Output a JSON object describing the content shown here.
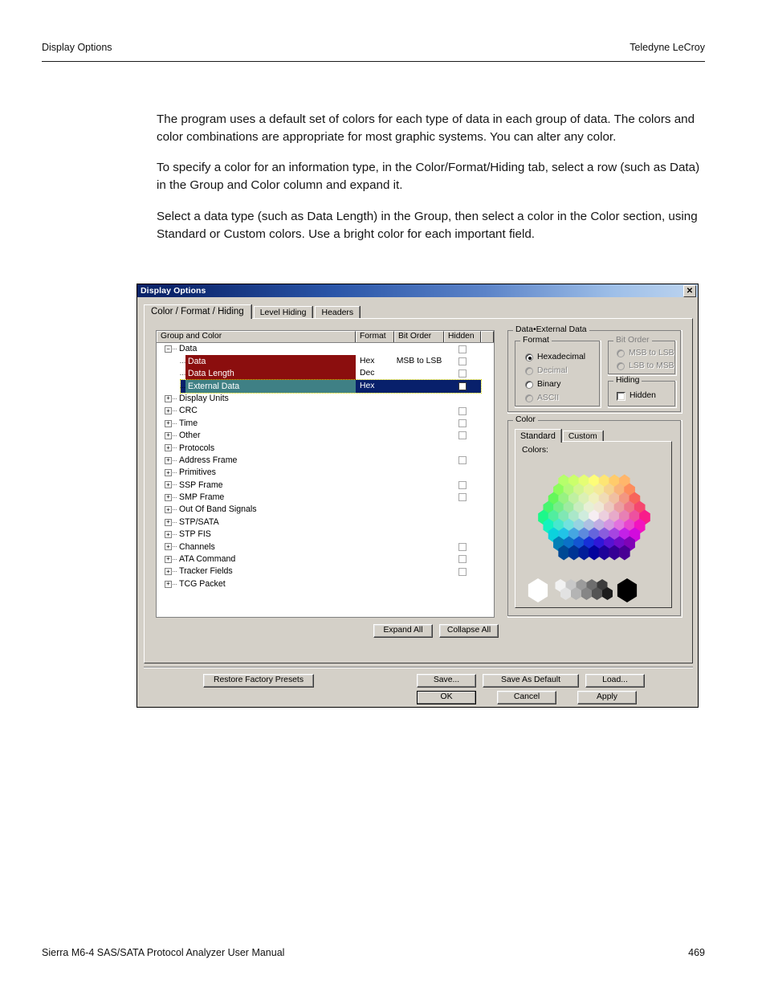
{
  "page": {
    "header_left": "Display Options",
    "header_right": "Teledyne LeCroy",
    "footer_left": "Sierra M6-4 SAS/SATA Protocol Analyzer User Manual",
    "footer_right": "469",
    "paragraphs": [
      "The program uses a default set of colors for each type of data in each group of data. The colors and color combinations are appropriate for most graphic systems. You can alter any color.",
      "To specify a color for an information type, in the Color/Format/Hiding tab, select a row (such as Data) in the Group and Color column and expand it.",
      "Select a data type (such as Data Length) in the Group, then select a color in the Color section, using Standard or Custom colors. Use a bright color for each important field."
    ]
  },
  "dialog": {
    "title": "Display Options",
    "close_label": "✕",
    "tabs": [
      {
        "label": "Color / Format / Hiding",
        "active": true
      },
      {
        "label": "Level Hiding",
        "active": false
      },
      {
        "label": "Headers",
        "active": false
      }
    ],
    "grid": {
      "columns": [
        "Group and Color",
        "Format",
        "Bit Order",
        "Hidden",
        ""
      ],
      "rows": [
        {
          "label": "Data",
          "level": 0,
          "twist": "−",
          "format": "",
          "bitorder": "",
          "checkbox": true,
          "selected": false,
          "color": ""
        },
        {
          "label": "Data",
          "level": 1,
          "twist": "",
          "format": "Hex",
          "bitorder": "MSB to LSB",
          "checkbox": true,
          "selected": false,
          "color": "#8b0e0e"
        },
        {
          "label": "Data Length",
          "level": 1,
          "twist": "",
          "format": "Dec",
          "bitorder": "",
          "checkbox": true,
          "selected": false,
          "color": "#8b0e0e"
        },
        {
          "label": "External Data",
          "level": 1,
          "twist": "",
          "format": "Hex",
          "bitorder": "",
          "checkbox": true,
          "selected": true,
          "color": "#3f8085"
        },
        {
          "label": "Display Units",
          "level": 0,
          "twist": "+",
          "format": "",
          "bitorder": "",
          "checkbox": false,
          "selected": false,
          "color": ""
        },
        {
          "label": "CRC",
          "level": 0,
          "twist": "+",
          "format": "",
          "bitorder": "",
          "checkbox": true,
          "selected": false,
          "color": ""
        },
        {
          "label": "Time",
          "level": 0,
          "twist": "+",
          "format": "",
          "bitorder": "",
          "checkbox": true,
          "selected": false,
          "color": ""
        },
        {
          "label": "Other",
          "level": 0,
          "twist": "+",
          "format": "",
          "bitorder": "",
          "checkbox": true,
          "selected": false,
          "color": ""
        },
        {
          "label": "Protocols",
          "level": 0,
          "twist": "+",
          "format": "",
          "bitorder": "",
          "checkbox": false,
          "selected": false,
          "color": ""
        },
        {
          "label": "Address Frame",
          "level": 0,
          "twist": "+",
          "format": "",
          "bitorder": "",
          "checkbox": true,
          "selected": false,
          "color": ""
        },
        {
          "label": "Primitives",
          "level": 0,
          "twist": "+",
          "format": "",
          "bitorder": "",
          "checkbox": false,
          "selected": false,
          "color": ""
        },
        {
          "label": "SSP Frame",
          "level": 0,
          "twist": "+",
          "format": "",
          "bitorder": "",
          "checkbox": true,
          "selected": false,
          "color": ""
        },
        {
          "label": "SMP Frame",
          "level": 0,
          "twist": "+",
          "format": "",
          "bitorder": "",
          "checkbox": true,
          "selected": false,
          "color": ""
        },
        {
          "label": "Out Of Band Signals",
          "level": 0,
          "twist": "+",
          "format": "",
          "bitorder": "",
          "checkbox": false,
          "selected": false,
          "color": ""
        },
        {
          "label": "STP/SATA",
          "level": 0,
          "twist": "+",
          "format": "",
          "bitorder": "",
          "checkbox": false,
          "selected": false,
          "color": ""
        },
        {
          "label": "STP FIS",
          "level": 0,
          "twist": "+",
          "format": "",
          "bitorder": "",
          "checkbox": false,
          "selected": false,
          "color": ""
        },
        {
          "label": "Channels",
          "level": 0,
          "twist": "+",
          "format": "",
          "bitorder": "",
          "checkbox": true,
          "selected": false,
          "color": ""
        },
        {
          "label": "ATA Command",
          "level": 0,
          "twist": "+",
          "format": "",
          "bitorder": "",
          "checkbox": true,
          "selected": false,
          "color": ""
        },
        {
          "label": "Tracker Fields",
          "level": 0,
          "twist": "+",
          "format": "",
          "bitorder": "",
          "checkbox": true,
          "selected": false,
          "color": ""
        },
        {
          "label": "TCG Packet",
          "level": 0,
          "twist": "+",
          "format": "",
          "bitorder": "",
          "checkbox": false,
          "selected": false,
          "color": ""
        }
      ],
      "expand_all": "Expand All",
      "collapse_all": "Collapse All"
    },
    "properties": {
      "group_title": "Data•External Data",
      "format": {
        "title": "Format",
        "options": [
          {
            "label": "Hexadecimal",
            "selected": true,
            "enabled": true
          },
          {
            "label": "Decimal",
            "selected": false,
            "enabled": false
          },
          {
            "label": "Binary",
            "selected": false,
            "enabled": true
          },
          {
            "label": "ASCII",
            "selected": false,
            "enabled": false
          }
        ]
      },
      "bit_order": {
        "title": "Bit Order",
        "enabled": false,
        "options": [
          {
            "label": "MSB to LSB",
            "selected": false,
            "enabled": false
          },
          {
            "label": "LSB to MSB",
            "selected": false,
            "enabled": false
          }
        ]
      },
      "hiding": {
        "title": "Hiding",
        "checkbox_label": "Hidden",
        "checked": false
      },
      "color": {
        "title": "Color",
        "tabs": [
          {
            "label": "Standard",
            "active": true
          },
          {
            "label": "Custom",
            "active": false
          }
        ],
        "colors_label": "Colors:"
      }
    },
    "buttons": {
      "restore": "Restore Factory Presets",
      "save": "Save...",
      "save_as_default": "Save As Default",
      "load": "Load...",
      "ok": "OK",
      "cancel": "Cancel",
      "apply": "Apply"
    }
  }
}
